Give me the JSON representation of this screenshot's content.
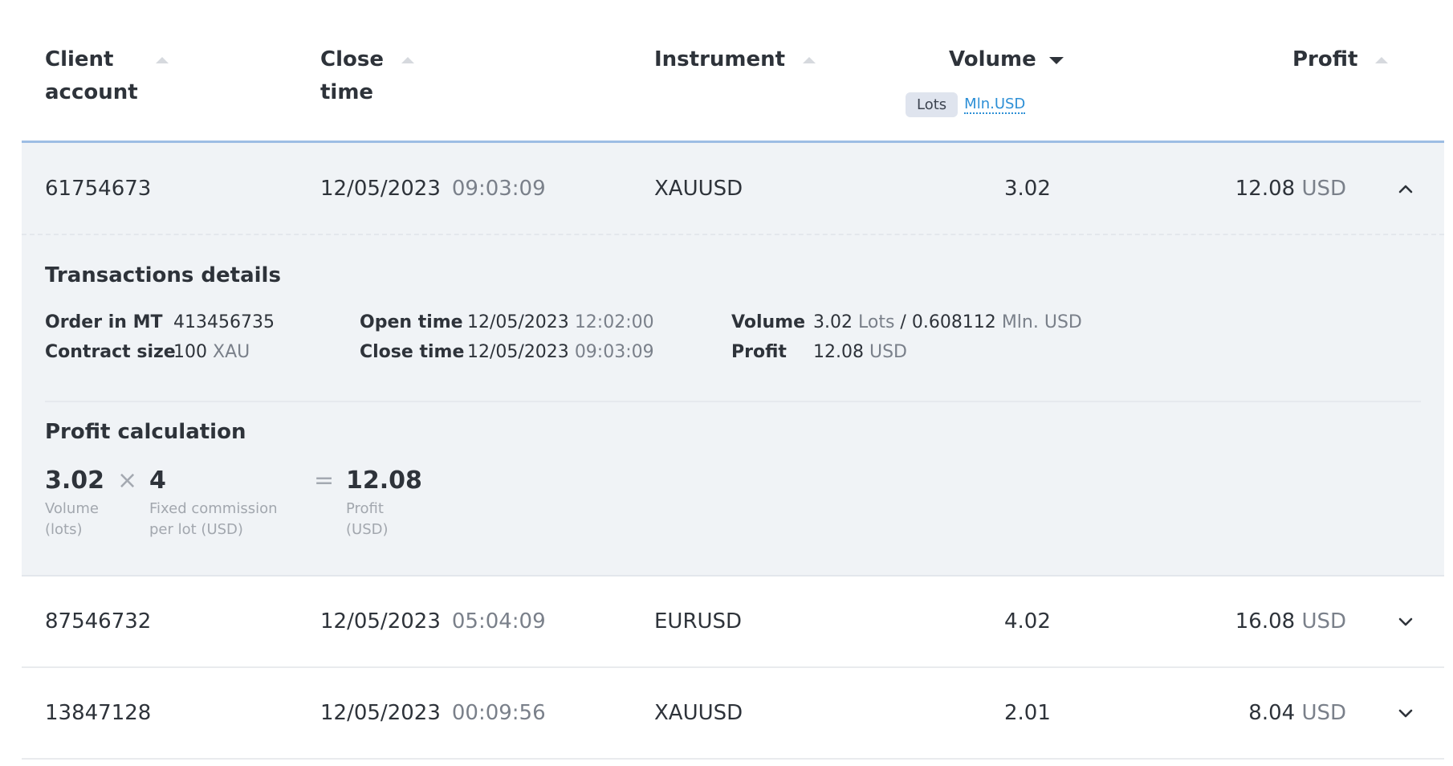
{
  "header": {
    "client_account": {
      "line1": "Client",
      "line2": "account"
    },
    "close_time": {
      "line1": "Close",
      "line2": "time"
    },
    "instrument": "Instrument",
    "volume": "Volume",
    "profit": "Profit",
    "volume_units": {
      "lots": "Lots",
      "mln_usd": "Mln.USD"
    }
  },
  "rows": [
    {
      "account": "61754673",
      "date": "12/05/2023",
      "time": "09:03:09",
      "instrument": "XAUUSD",
      "volume": "3.02",
      "profit": "12.08",
      "currency": "USD",
      "expanded": true
    },
    {
      "account": "87546732",
      "date": "12/05/2023",
      "time": "05:04:09",
      "instrument": "EURUSD",
      "volume": "4.02",
      "profit": "16.08",
      "currency": "USD",
      "expanded": false
    },
    {
      "account": "13847128",
      "date": "12/05/2023",
      "time": "00:09:56",
      "instrument": "XAUUSD",
      "volume": "2.01",
      "profit": "8.04",
      "currency": "USD",
      "expanded": false
    }
  ],
  "details": {
    "title": "Transactions details",
    "order_in_mt_label": "Order in MT",
    "order_in_mt": "413456735",
    "contract_size_label": "Contract size",
    "contract_size": "100",
    "contract_size_unit": "XAU",
    "open_time_label": "Open time",
    "open_date": "12/05/2023",
    "open_time": "12:02:00",
    "close_time_label": "Close time",
    "close_date": "12/05/2023",
    "close_time": "09:03:09",
    "volume_label": "Volume",
    "volume_lots": "3.02",
    "volume_lots_unit": "Lots",
    "volume_sep": "/",
    "volume_mln": "0.608112",
    "volume_mln_unit": "Mln. USD",
    "profit_label": "Profit",
    "profit_value": "12.08",
    "profit_unit": "USD"
  },
  "calculation": {
    "title": "Profit calculation",
    "volume": "3.02",
    "volume_label_1": "Volume",
    "volume_label_2": "(lots)",
    "times": "×",
    "commission": "4",
    "commission_label_1": "Fixed commission",
    "commission_label_2": "per lot (USD)",
    "equals": "=",
    "result": "12.08",
    "result_label_1": "Profit",
    "result_label_2": "(USD)"
  },
  "icons": {
    "sort_asc": "sort-up-icon",
    "sort_desc": "sort-down-icon",
    "expand": "chevron-down-icon",
    "collapse": "chevron-up-icon"
  },
  "colors": {
    "accent_blue": "#2d8fd6",
    "header_border": "#9dbde4",
    "expanded_bg": "#f0f3f6"
  }
}
